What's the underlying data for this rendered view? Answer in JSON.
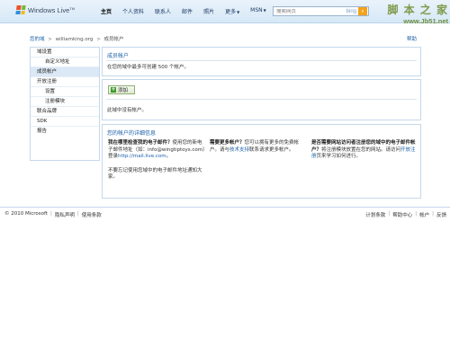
{
  "header": {
    "brand": "Windows Live",
    "brand_tm": "TM",
    "nav": [
      {
        "label": "主页",
        "active": true
      },
      {
        "label": "个人资料",
        "active": false
      },
      {
        "label": "联系人",
        "active": false
      },
      {
        "label": "邮件",
        "active": false
      },
      {
        "label": "照片",
        "active": false
      },
      {
        "label": "更多",
        "active": false,
        "dropdown": true
      },
      {
        "label": "MSN",
        "active": false,
        "dropdown": true
      }
    ],
    "search": {
      "placeholder": "搜索网页",
      "engine": "bing",
      "go_icon": "search-go-icon"
    },
    "watermark": {
      "title": "脚 本 之 家",
      "url": "www.Jb51.net"
    }
  },
  "breadcrumb": {
    "items": [
      "您的域",
      "williamking.org",
      "成员帐户"
    ],
    "separator": ">",
    "help": "帮助"
  },
  "sidebar": {
    "items": [
      {
        "label": "域设置",
        "sub": false
      },
      {
        "label": "自定义地址",
        "sub": true
      },
      {
        "label": "成员帐户",
        "sub": false,
        "selected": true
      },
      {
        "label": "开放注册",
        "sub": false
      },
      {
        "label": "设置",
        "sub": true
      },
      {
        "label": "注册模块",
        "sub": true
      },
      {
        "label": "联合品牌",
        "sub": false
      },
      {
        "label": "SDK",
        "sub": false
      },
      {
        "label": "报告",
        "sub": false
      }
    ]
  },
  "panel_members": {
    "title": "成员帐户",
    "desc": "在您的域中最多可创建 500 个帐户。"
  },
  "panel_list": {
    "add_label": "添加",
    "empty": "此域中没有帐户。"
  },
  "panel_details": {
    "title": "您的帐户的详细信息",
    "col1": {
      "q": "我在哪里检查我的电子邮件？",
      "text1": "使用您的新电子邮件地址（如：",
      "email": "info@wingtiptoys.com",
      "text2": "）登录",
      "link": "http://mail.live.com",
      "text3": "。",
      "note": "不要忘记使用您域中的电子邮件地址通知大家。"
    },
    "col2": {
      "q": "需要更多帐户？",
      "text1": "您可以拥有更多的免费帐户。请与",
      "link": "技术支持",
      "text2": "联系请求更多帐户。"
    },
    "col3": {
      "q": "是否需要网站访问者注册您的域中的电子邮件帐户？",
      "text1": "将注册模块放置在您的网站。请访问",
      "link": "开放注册",
      "text2": "页来学习如何进行。"
    }
  },
  "footer": {
    "copyright": "© 2010 Microsoft",
    "left_links": [
      "隐私声明",
      "使用条款"
    ],
    "right_links": [
      "计划条款",
      "帮助中心",
      "帐户",
      "反馈"
    ]
  }
}
